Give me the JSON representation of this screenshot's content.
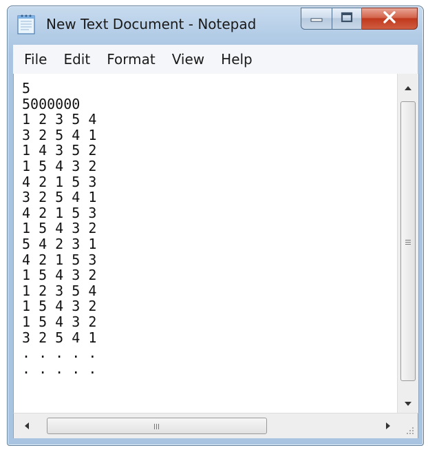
{
  "window": {
    "title": "New Text Document - Notepad"
  },
  "menu": {
    "items": [
      "File",
      "Edit",
      "Format",
      "View",
      "Help"
    ]
  },
  "editor": {
    "content": "5\n5000000\n1 2 3 5 4\n3 2 5 4 1\n1 4 3 5 2\n1 5 4 3 2\n4 2 1 5 3\n3 2 5 4 1\n4 2 1 5 3\n1 5 4 3 2\n5 4 2 3 1\n4 2 1 5 3\n1 5 4 3 2\n1 2 3 5 4\n1 5 4 3 2\n1 5 4 3 2\n3 2 5 4 1\n. . . . .\n. . . . ."
  },
  "icons": {
    "app": "notepad-icon",
    "minimize": "minimize-icon",
    "maximize": "maximize-icon",
    "close": "close-icon",
    "scroll_up": "arrow-up-icon",
    "scroll_down": "arrow-down-icon",
    "scroll_left": "arrow-left-icon",
    "scroll_right": "arrow-right-icon",
    "grip": "size-grip-icon"
  },
  "colors": {
    "close_button": "#c0391f",
    "frame": "#b4cde7",
    "menu_bg": "#f4f6f9"
  }
}
